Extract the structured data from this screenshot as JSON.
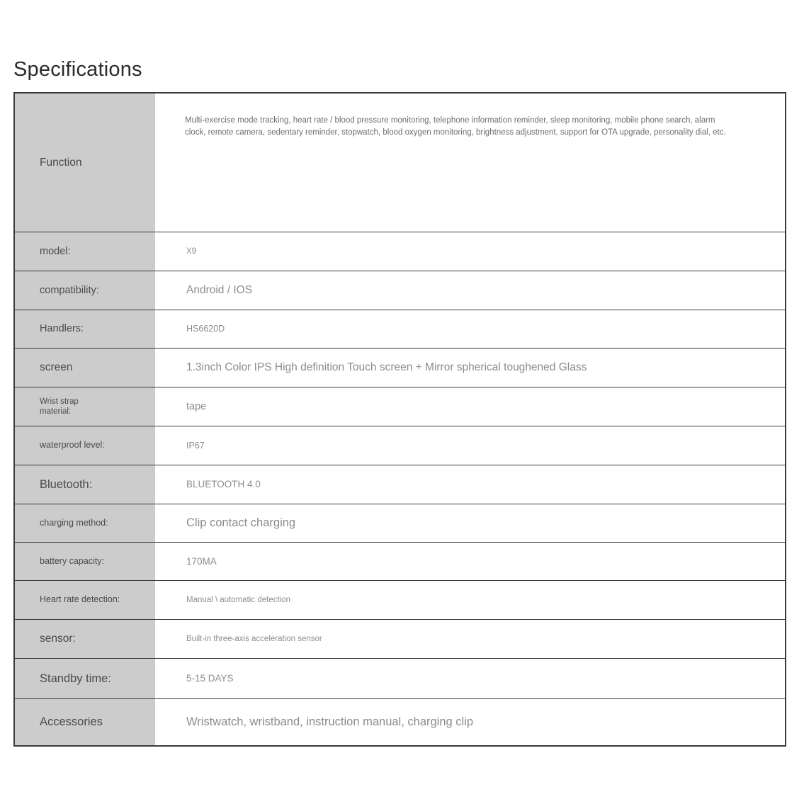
{
  "page": {
    "title": "Specifications"
  },
  "table": {
    "rows": [
      {
        "label": "Function",
        "value": "Multi-exercise mode tracking, heart rate / blood pressure monitoring, telephone information reminder, sleep monitoring, mobile phone search, alarm clock, remote camera, sedentary reminder, stopwatch, blood oxygen monitoring, brightness adjustment, support for OTA upgrade, personality dial, etc."
      },
      {
        "label": "model:",
        "value": "X9"
      },
      {
        "label": "compatibility:",
        "value": "Android / IOS"
      },
      {
        "label": "Handlers:",
        "value": "HS6620D"
      },
      {
        "label": "screen",
        "value": "1.3inch Color IPS High definition Touch screen + Mirror spherical toughened Glass"
      },
      {
        "label": "Wrist strap\nmaterial:",
        "value": "tape"
      },
      {
        "label": "waterproof level:",
        "value": "IP67"
      },
      {
        "label": "Bluetooth:",
        "value": "BLUETOOTH 4.0"
      },
      {
        "label": "charging method:",
        "value": "Clip contact charging"
      },
      {
        "label": "battery capacity:",
        "value": "170MA"
      },
      {
        "label": "Heart rate detection:",
        "value": "Manual \\ automatic detection"
      },
      {
        "label": "sensor:",
        "value": "Built-in three-axis acceleration sensor"
      },
      {
        "label": "Standby time:",
        "value": "5-15 DAYS"
      },
      {
        "label": "Accessories",
        "value": "Wristwatch, wristband, instruction manual, charging clip"
      }
    ]
  },
  "colors": {
    "label_background": "#cccccc",
    "border": "#3a3a3a",
    "label_text": "#4a4a4a",
    "value_text": "#8c8c8c",
    "title_text": "#2b2b2b",
    "page_background": "#ffffff"
  }
}
